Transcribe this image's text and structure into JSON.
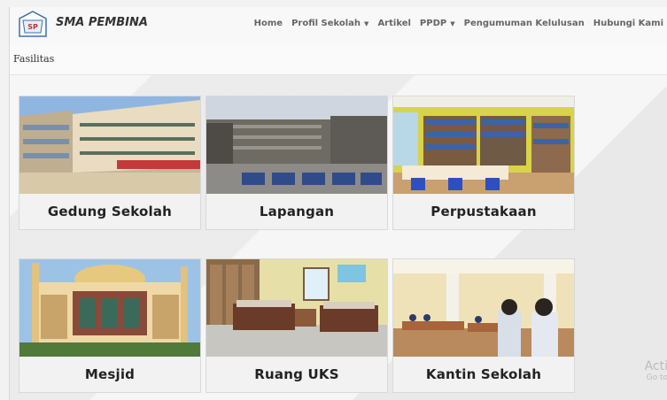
{
  "brand": {
    "name": "SMA PEMBINA"
  },
  "nav": {
    "items": [
      {
        "label": "Home",
        "has_dropdown": false
      },
      {
        "label": "Profil Sekolah",
        "has_dropdown": true
      },
      {
        "label": "Artikel",
        "has_dropdown": false
      },
      {
        "label": "PPDP",
        "has_dropdown": true
      },
      {
        "label": "Pengumuman Kelulusan",
        "has_dropdown": false
      },
      {
        "label": "Hubungi Kami",
        "has_dropdown": false
      }
    ]
  },
  "breadcrumb": {
    "current": "Fasilitas"
  },
  "facilities": [
    {
      "label": "Gedung Sekolah",
      "image": "school-building-photo"
    },
    {
      "label": "Lapangan",
      "image": "field-photo"
    },
    {
      "label": "Perpustakaan",
      "image": "library-photo"
    },
    {
      "label": "Mesjid",
      "image": "mosque-photo"
    },
    {
      "label": "Ruang UKS",
      "image": "health-room-photo"
    },
    {
      "label": "Kantin Sekolah",
      "image": "canteen-photo"
    }
  ],
  "watermark": {
    "line1": "Acti",
    "line2": "Go to"
  }
}
